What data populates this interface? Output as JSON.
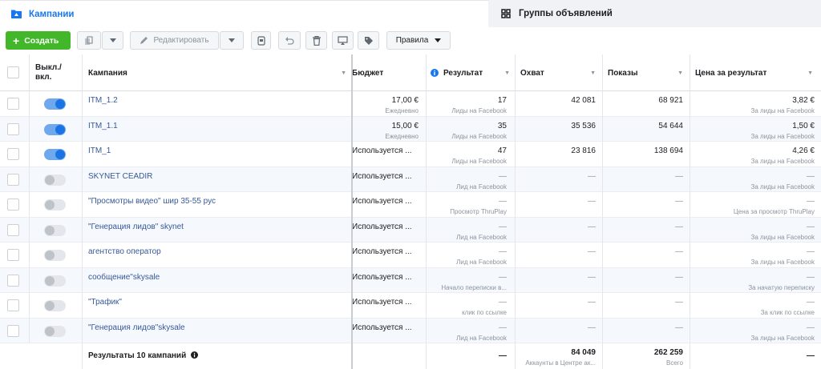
{
  "tabs": {
    "campaigns": "Кампании",
    "adsets": "Группы объявлений"
  },
  "toolbar": {
    "create_label": "Создать",
    "edit_label": "Редактировать",
    "rules_label": "Правила"
  },
  "columns": {
    "toggle": "Выкл./\nвкл.",
    "campaign": "Кампания",
    "budget": "Бюджет",
    "result": "Результат",
    "reach": "Охват",
    "impressions": "Показы",
    "cost": "Цена за результат"
  },
  "rows": [
    {
      "name": "ITM_1.2",
      "on": true,
      "budget": "17,00 €",
      "budget_sub": "Ежедневно",
      "result": "17",
      "result_sub": "Лиды на Facebook",
      "reach": "42 081",
      "impressions": "68 921",
      "cost": "3,82 €",
      "cost_sub": "За лиды на Facebook"
    },
    {
      "name": "ITM_1.1",
      "on": true,
      "budget": "15,00 €",
      "budget_sub": "Ежедневно",
      "result": "35",
      "result_sub": "Лиды на Facebook",
      "reach": "35 536",
      "impressions": "54 644",
      "cost": "1,50 €",
      "cost_sub": "За лиды на Facebook"
    },
    {
      "name": "ITM_1",
      "on": true,
      "budget": "Используется ...",
      "budget_sub": "",
      "result": "47",
      "result_sub": "Лиды на Facebook",
      "reach": "23 816",
      "impressions": "138 694",
      "cost": "4,26 €",
      "cost_sub": "За лиды на Facebook"
    },
    {
      "name": "SKYNET CEADIR",
      "on": false,
      "budget": "Используется ...",
      "budget_sub": "",
      "result": "—",
      "result_sub": "Лид на Facebook",
      "reach": "—",
      "impressions": "—",
      "cost": "—",
      "cost_sub": "За лиды на Facebook"
    },
    {
      "name": "\"Просмотры видео\" шир 35-55 рус",
      "on": false,
      "budget": "Используется ...",
      "budget_sub": "",
      "result": "—",
      "result_sub": "Просмотр ThruPlay",
      "reach": "—",
      "impressions": "—",
      "cost": "—",
      "cost_sub": "Цена за просмотр ThruPlay"
    },
    {
      "name": "\"Генерация лидов\" skynet",
      "on": false,
      "budget": "Используется ...",
      "budget_sub": "",
      "result": "—",
      "result_sub": "Лид на Facebook",
      "reach": "—",
      "impressions": "—",
      "cost": "—",
      "cost_sub": "За лиды на Facebook"
    },
    {
      "name": "агентство оператор",
      "on": false,
      "budget": "Используется ...",
      "budget_sub": "",
      "result": "—",
      "result_sub": "Лид на Facebook",
      "reach": "—",
      "impressions": "—",
      "cost": "—",
      "cost_sub": "За лиды на Facebook"
    },
    {
      "name": "сообщение\"skysale",
      "on": false,
      "budget": "Используется ...",
      "budget_sub": "",
      "result": "—",
      "result_sub": "Начало переписки в...",
      "reach": "—",
      "impressions": "—",
      "cost": "—",
      "cost_sub": "За начатую переписку"
    },
    {
      "name": "\"Трафик\"",
      "on": false,
      "budget": "Используется ...",
      "budget_sub": "",
      "result": "—",
      "result_sub": "клик по ссылке",
      "reach": "—",
      "impressions": "—",
      "cost": "—",
      "cost_sub": "За клик по ссылке"
    },
    {
      "name": "\"Генерация лидов\"skysale",
      "on": false,
      "budget": "Используется ...",
      "budget_sub": "",
      "result": "—",
      "result_sub": "Лид на Facebook",
      "reach": "—",
      "impressions": "—",
      "cost": "—",
      "cost_sub": "За лиды на Facebook"
    }
  ],
  "totals": {
    "label": "Результаты 10 кампаний",
    "result": "—",
    "reach": "84 049",
    "reach_sub": "Аккаунты в Центре ак...",
    "impressions": "262 259",
    "impressions_sub": "Всего",
    "cost": "—"
  },
  "colors": {
    "accent": "#1877f2",
    "create": "#42b72a",
    "toggle_on": "#1b74e4",
    "link": "#385898"
  }
}
